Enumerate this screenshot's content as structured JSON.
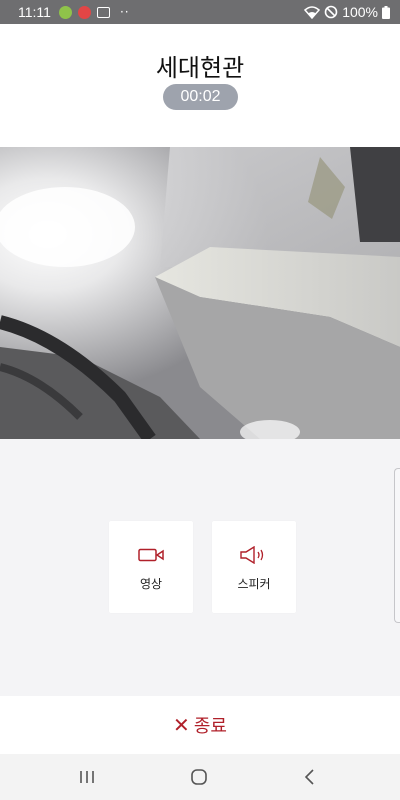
{
  "status_bar": {
    "time": "11:11",
    "dots": "··",
    "battery": "100%"
  },
  "header": {
    "title": "세대현관",
    "timer": "00:02"
  },
  "controls": {
    "video_label": "영상",
    "speaker_label": "스피커",
    "accent_color": "#b0202a"
  },
  "end_call": {
    "x_glyph": "✕",
    "label": "종료"
  },
  "icons": [
    "wifi-icon",
    "no-disturb-icon",
    "battery-icon",
    "video-camera-icon",
    "speaker-icon",
    "recents-icon",
    "home-icon",
    "back-icon"
  ]
}
